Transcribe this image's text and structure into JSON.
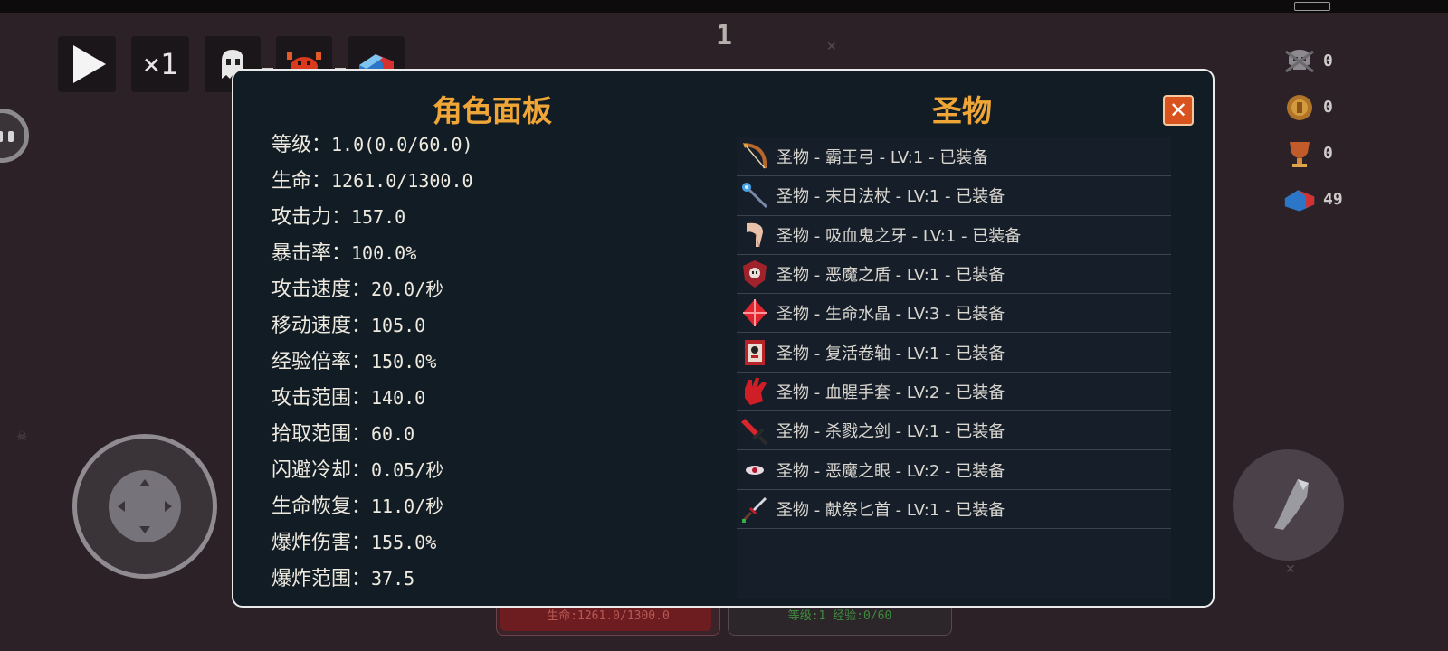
{
  "hud": {
    "timer": "1",
    "speed_label": "×1"
  },
  "counters": [
    {
      "icon": "skull-icon",
      "value": "0"
    },
    {
      "icon": "coin-icon",
      "value": "0"
    },
    {
      "icon": "trophy-icon",
      "value": "0"
    },
    {
      "icon": "magnet-icon",
      "value": "49"
    }
  ],
  "bottom": {
    "hp_text": "生命:1261.0/1300.0",
    "hp_fraction": 0.97,
    "xp_text": "等级:1 经验:0/60"
  },
  "panel": {
    "left_title": "角色面板",
    "right_title": "圣物",
    "close_label": "✕",
    "stats": [
      {
        "k": "等级：",
        "v": "1.0(0.0/60.0)"
      },
      {
        "k": "生命：",
        "v": "1261.0/1300.0"
      },
      {
        "k": "攻击力：",
        "v": "157.0"
      },
      {
        "k": "暴击率：",
        "v": "100.0%"
      },
      {
        "k": "攻击速度：",
        "v": "20.0/秒"
      },
      {
        "k": "移动速度：",
        "v": "105.0"
      },
      {
        "k": "经验倍率：",
        "v": "150.0%"
      },
      {
        "k": "攻击范围：",
        "v": "140.0"
      },
      {
        "k": "拾取范围：",
        "v": "60.0"
      },
      {
        "k": "闪避冷却：",
        "v": "0.05/秒"
      },
      {
        "k": "生命恢复：",
        "v": "11.0/秒"
      },
      {
        "k": "爆炸伤害：",
        "v": "155.0%"
      },
      {
        "k": "爆炸范围：",
        "v": "37.5"
      }
    ],
    "relics": [
      {
        "icon": "bow-icon",
        "text": "圣物 - 霸王弓 - LV:1 - 已装备"
      },
      {
        "icon": "staff-icon",
        "text": "圣物 - 末日法杖 - LV:1 - 已装备"
      },
      {
        "icon": "fang-icon",
        "text": "圣物 - 吸血鬼之牙 - LV:1 - 已装备"
      },
      {
        "icon": "shield-icon",
        "text": "圣物 - 恶魔之盾 - LV:1 - 已装备"
      },
      {
        "icon": "crystal-icon",
        "text": "圣物 - 生命水晶 - LV:3 - 已装备"
      },
      {
        "icon": "scroll-icon",
        "text": "圣物 - 复活卷轴 - LV:1 - 已装备"
      },
      {
        "icon": "glove-icon",
        "text": "圣物 - 血腥手套 - LV:2 - 已装备"
      },
      {
        "icon": "sword-icon",
        "text": "圣物 - 杀戮之剑 - LV:1 - 已装备"
      },
      {
        "icon": "eye-icon",
        "text": "圣物 - 恶魔之眼 - LV:2 - 已装备"
      },
      {
        "icon": "dagger-icon",
        "text": "圣物 - 献祭匕首 - LV:1 - 已装备"
      }
    ]
  }
}
